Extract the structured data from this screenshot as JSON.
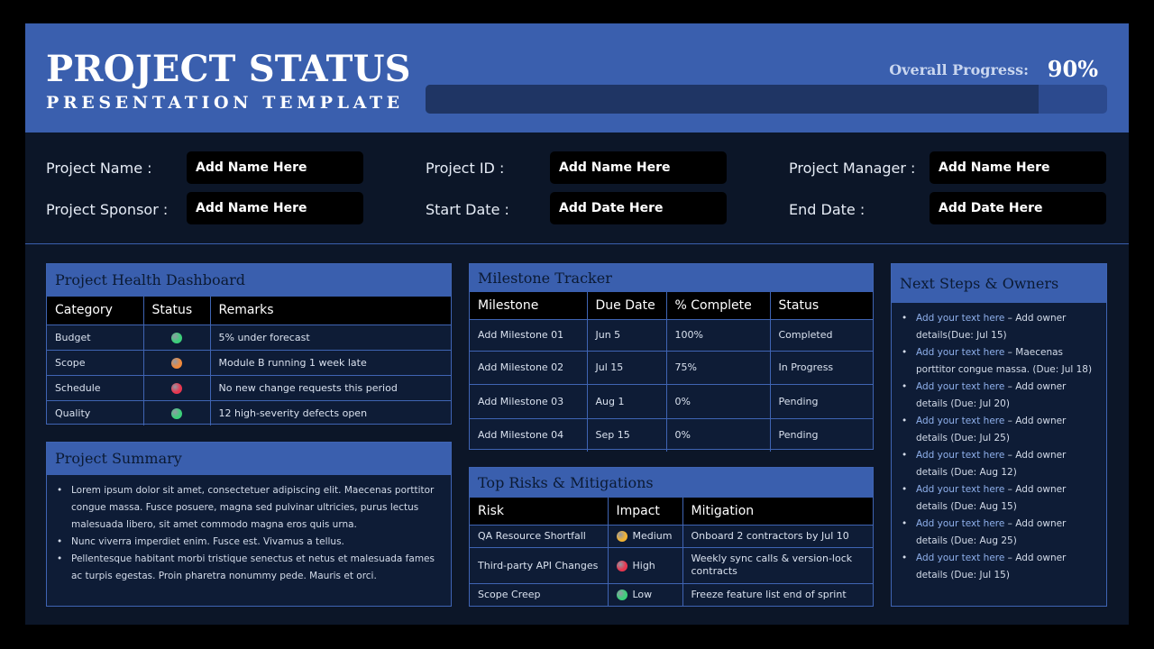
{
  "header": {
    "title": "PROJECT STATUS",
    "subtitle": "PRESENTATION TEMPLATE",
    "progress_label": "Overall Progress:",
    "progress_value": "90%",
    "progress_fraction": 0.9
  },
  "info": {
    "project_name_label": "Project Name :",
    "project_name_value": "Add Name Here",
    "project_id_label": "Project ID :",
    "project_id_value": "Add Name Here",
    "project_manager_label": "Project Manager :",
    "project_manager_value": "Add Name Here",
    "project_sponsor_label": "Project Sponsor :",
    "project_sponsor_value": "Add Name Here",
    "start_date_label": "Start Date :",
    "start_date_value": "Add Date Here",
    "end_date_label": "End Date :",
    "end_date_value": "Add Date Here"
  },
  "health": {
    "title": "Project Health Dashboard",
    "columns": [
      "Category",
      "Status",
      "Remarks"
    ],
    "rows": [
      {
        "category": "Budget",
        "status_color": "#3ccf7a",
        "remarks": "5% under forecast"
      },
      {
        "category": "Scope",
        "status_color": "#f08a3c",
        "remarks": "Module B running 1 week late"
      },
      {
        "category": "Schedule",
        "status_color": "#e8364f",
        "remarks": "No new change requests this period"
      },
      {
        "category": "Quality",
        "status_color": "#3ccf7a",
        "remarks": "12 high-severity defects open"
      }
    ]
  },
  "summary": {
    "title": "Project Summary",
    "bullets": [
      "Lorem ipsum dolor sit amet, consectetuer adipiscing elit. Maecenas porttitor congue massa. Fusce posuere, magna sed pulvinar ultricies, purus lectus malesuada libero, sit amet commodo magna eros quis urna.",
      "Nunc viverra imperdiet enim. Fusce est. Vivamus a tellus.",
      "Pellentesque habitant morbi tristique senectus et netus et malesuada fames ac turpis egestas. Proin pharetra nonummy pede. Mauris et orci."
    ]
  },
  "milestones": {
    "title": "Milestone Tracker",
    "columns": [
      "Milestone",
      "Due Date",
      "% Complete",
      "Status"
    ],
    "rows": [
      {
        "name": "Add Milestone 01",
        "due": "Jun 5",
        "complete": "100%",
        "status": "Completed"
      },
      {
        "name": "Add Milestone 02",
        "due": "Jul 15",
        "complete": "75%",
        "status": "In Progress"
      },
      {
        "name": "Add Milestone 03",
        "due": "Aug 1",
        "complete": "0%",
        "status": "Pending"
      },
      {
        "name": "Add Milestone 04",
        "due": "Sep 15",
        "complete": "0%",
        "status": "Pending"
      }
    ]
  },
  "risks": {
    "title": "Top Risks & Mitigations",
    "columns": [
      "Risk",
      "Impact",
      "Mitigation"
    ],
    "rows": [
      {
        "risk": "QA Resource Shortfall",
        "impact": "Medium",
        "impact_color": "#f2b233",
        "mitigation": "Onboard 2 contractors by Jul 10"
      },
      {
        "risk": "Third-party API Changes",
        "impact": "High",
        "impact_color": "#e8364f",
        "mitigation": "Weekly sync calls & version-lock contracts"
      },
      {
        "risk": "Scope Creep",
        "impact": "Low",
        "impact_color": "#3ccf7a",
        "mitigation": "Freeze feature list end of sprint"
      }
    ]
  },
  "next_steps": {
    "title": "Next Steps & Owners",
    "items": [
      {
        "accent": "Add your text here",
        "rest": " – Add owner details(Due: Jul 15)"
      },
      {
        "accent": "Add your text here",
        "rest": " – Maecenas porttitor congue massa. (Due: Jul 18)"
      },
      {
        "accent": "Add your text here",
        "rest": " – Add owner details (Due: Jul 20)"
      },
      {
        "accent": "Add your text here",
        "rest": " – Add owner details (Due: Jul 25)"
      },
      {
        "accent": "Add your text here",
        "rest": " – Add owner details (Due: Aug 12)"
      },
      {
        "accent": "Add your text here",
        "rest": " – Add owner details (Due: Aug 15)"
      },
      {
        "accent": "Add your text here",
        "rest": " – Add owner details (Due: Aug 25)"
      },
      {
        "accent": "Add your text here",
        "rest": " – Add owner details (Due: Jul 15)"
      }
    ]
  }
}
